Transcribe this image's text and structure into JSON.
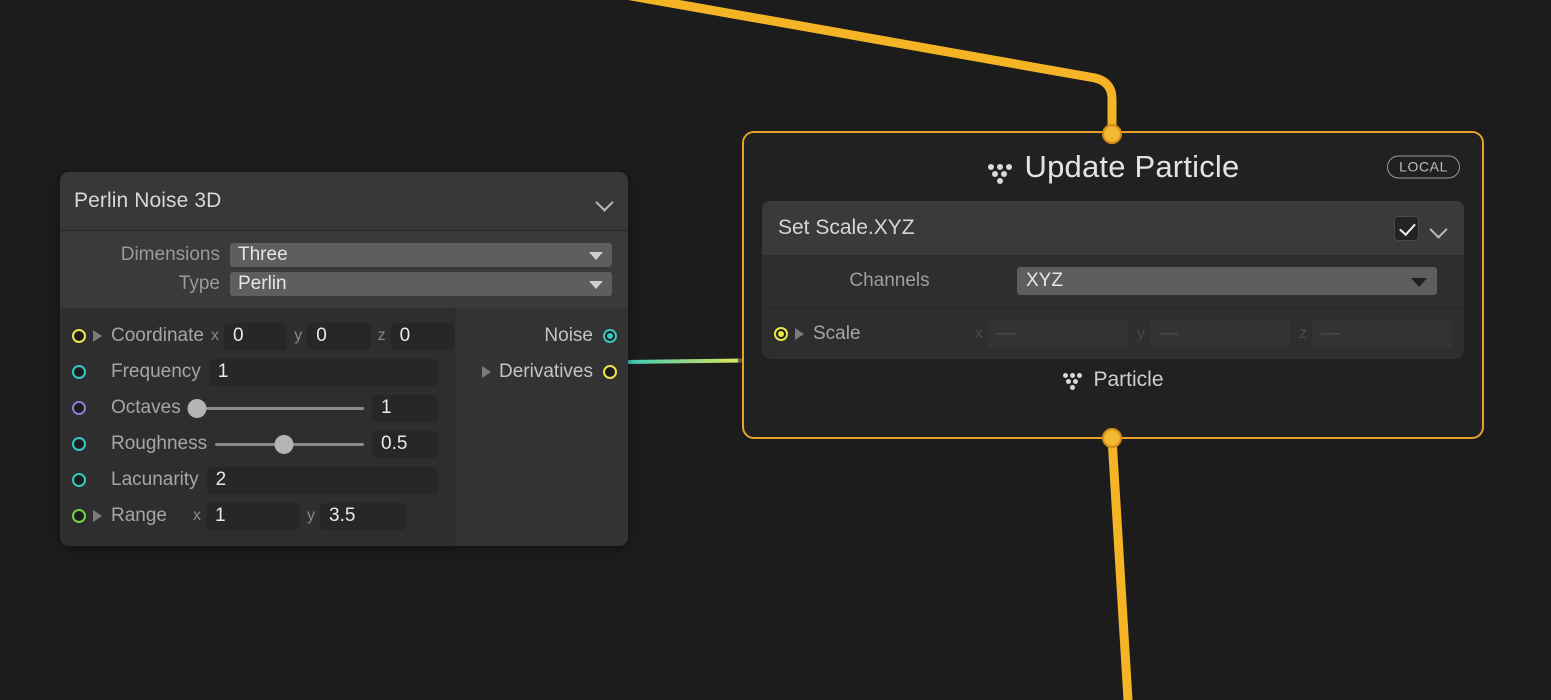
{
  "canvas": {
    "background": "#1c1c1c"
  },
  "colors": {
    "accent_orange": "#f2b733",
    "wire_orange": "#f5b426",
    "socket_cyan": "#35c9c0",
    "socket_yellow": "#e8e84a",
    "socket_purple": "#8f7bdc",
    "socket_green": "#6fd44a",
    "node_border": "#e9a12a"
  },
  "perlin_node": {
    "title": "Perlin Noise 3D",
    "collapse_icon": "chevron-down-icon",
    "properties": [
      {
        "label": "Dimensions",
        "value": "Three",
        "icon": "dropdown-triangle-icon"
      },
      {
        "label": "Type",
        "value": "Perlin",
        "icon": "dropdown-triangle-icon"
      }
    ],
    "inputs": [
      {
        "label": "Coordinate",
        "kind": "vector3",
        "socket_color": "#e8e84a",
        "expandable": true,
        "filled": false,
        "axes": [
          {
            "axis": "x",
            "value": "0"
          },
          {
            "axis": "y",
            "value": "0"
          },
          {
            "axis": "z",
            "value": "0"
          }
        ]
      },
      {
        "label": "Frequency",
        "kind": "field",
        "socket_color": "#35c9c0",
        "expandable": false,
        "filled": false,
        "value": "1"
      },
      {
        "label": "Octaves",
        "kind": "slider",
        "socket_color": "#8f7bdc",
        "expandable": false,
        "filled": false,
        "value": "1",
        "slider_pct": 5
      },
      {
        "label": "Roughness",
        "kind": "slider",
        "socket_color": "#35c9c0",
        "expandable": false,
        "filled": false,
        "value": "0.5",
        "slider_pct": 46
      },
      {
        "label": "Lacunarity",
        "kind": "field",
        "socket_color": "#35c9c0",
        "expandable": false,
        "filled": false,
        "value": "2"
      },
      {
        "label": "Range",
        "kind": "vector2",
        "socket_color": "#6fd44a",
        "expandable": true,
        "filled": false,
        "axes": [
          {
            "axis": "x",
            "value": "1"
          },
          {
            "axis": "y",
            "value": "3.5"
          }
        ]
      }
    ],
    "outputs": [
      {
        "label": "Noise",
        "socket_color": "#35c9c0",
        "filled": true,
        "expandable": false
      },
      {
        "label": "Derivatives",
        "socket_color": "#e8e84a",
        "filled": false,
        "expandable": true
      }
    ]
  },
  "update_node": {
    "title": "Update Particle",
    "header_icon": "particle-icon",
    "badge": "LOCAL",
    "block": {
      "title": "Set Scale.XYZ",
      "checkbox_checked": true,
      "collapse_icon": "chevron-down-icon",
      "rows": [
        {
          "label": "Channels",
          "type": "dropdown",
          "value": "XYZ",
          "icon": "dropdown-triangle-icon"
        }
      ],
      "scale_row": {
        "label": "Scale",
        "socket_color": "#e8e84a",
        "filled": true,
        "expandable": true,
        "disabled": true,
        "axes": [
          {
            "axis": "x",
            "value": "—"
          },
          {
            "axis": "y",
            "value": "—"
          },
          {
            "axis": "z",
            "value": "—"
          }
        ]
      }
    },
    "footer": {
      "label": "Particle",
      "icon": "particle-icon"
    }
  },
  "wires": [
    {
      "name": "noise-to-scale-wire",
      "from": "Noise",
      "to": "Scale",
      "color_start": "#35c9c0",
      "color_end": "#e8e84a"
    },
    {
      "name": "flow-in-wire",
      "color": "#f5b426"
    },
    {
      "name": "flow-out-wire",
      "color": "#f5b426"
    }
  ]
}
